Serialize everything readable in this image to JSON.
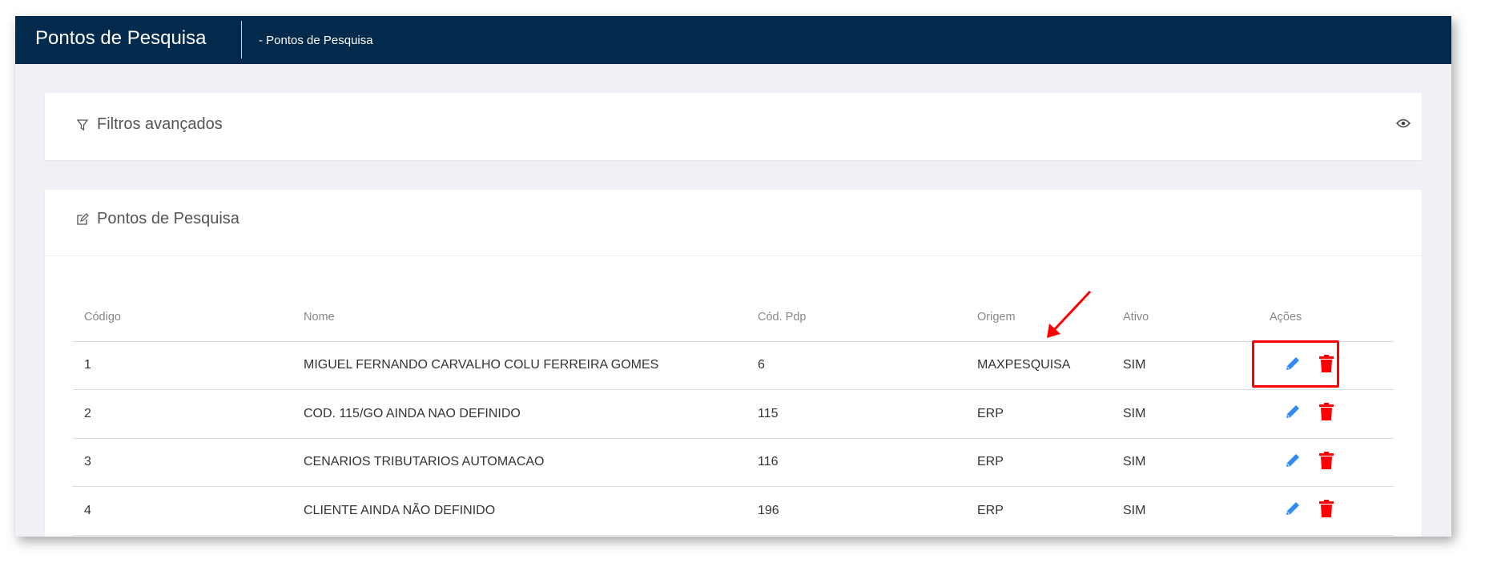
{
  "header": {
    "title": "Pontos de Pesquisa",
    "breadcrumb": "- Pontos de Pesquisa"
  },
  "filters": {
    "title": "Filtros avançados"
  },
  "list": {
    "title": "Pontos de Pesquisa",
    "columns": [
      "Código",
      "Nome",
      "Cód. Pdp",
      "Origem",
      "Ativo",
      "Ações"
    ],
    "rows": [
      {
        "codigo": "1",
        "nome": "MIGUEL FERNANDO CARVALHO COLU FERREIRA GOMES",
        "pdp": "6",
        "origem": "MAXPESQUISA",
        "ativo": "SIM"
      },
      {
        "codigo": "2",
        "nome": "COD. 115/GO AINDA NAO DEFINIDO",
        "pdp": "115",
        "origem": "ERP",
        "ativo": "SIM"
      },
      {
        "codigo": "3",
        "nome": "CENARIOS TRIBUTARIOS AUTOMACAO",
        "pdp": "116",
        "origem": "ERP",
        "ativo": "SIM"
      },
      {
        "codigo": "4",
        "nome": "CLIENTE AINDA NÃO DEFINIDO",
        "pdp": "196",
        "origem": "ERP",
        "ativo": "SIM"
      }
    ]
  },
  "colors": {
    "header": "#022a4d",
    "edit": "#2f8cf5",
    "delete": "#ff0000",
    "annotation": "#ff0000"
  }
}
